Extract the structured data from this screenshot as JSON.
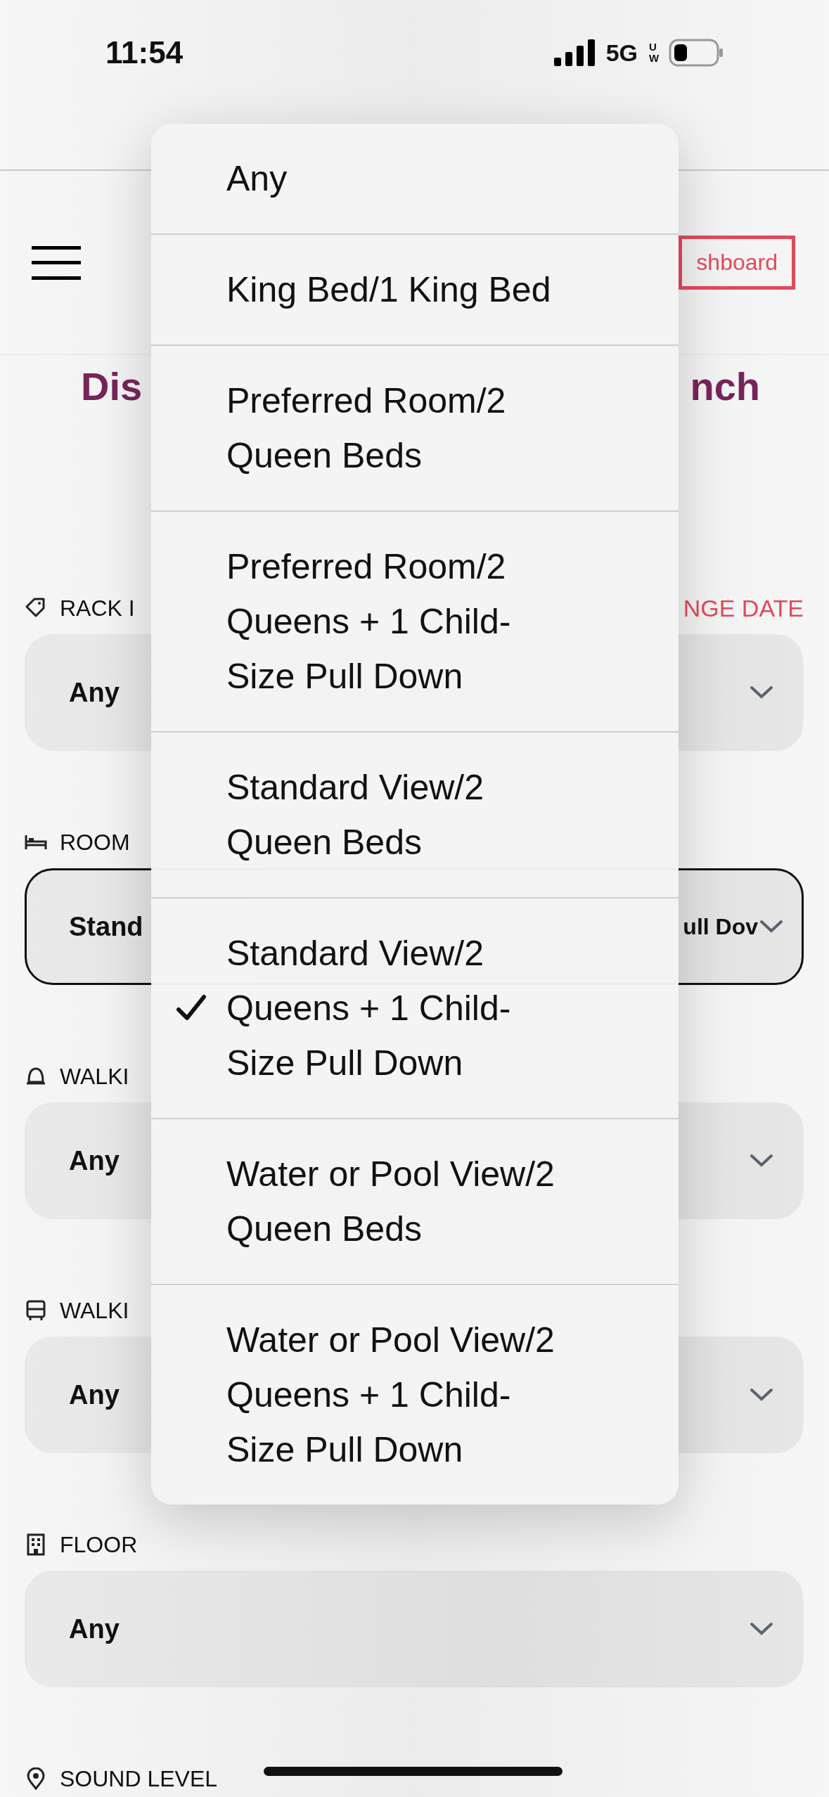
{
  "status_bar": {
    "time": "11:54",
    "network": "5G",
    "network_badge": "UW"
  },
  "header": {
    "dashboard_link": "shboard"
  },
  "title": {
    "left": "Dis",
    "right": "nch"
  },
  "fields": [
    {
      "kind": "tag",
      "label": "RACK I",
      "aside": "NGE DATE",
      "value": "Any",
      "focused": false
    },
    {
      "kind": "bed",
      "label": "ROOM",
      "value": "Stand",
      "value_end": "ull Dov",
      "focused": true
    },
    {
      "kind": "bell",
      "label": "WALKI",
      "value": "Any",
      "focused": false
    },
    {
      "kind": "bus",
      "label": "WALKI",
      "value": "Any",
      "focused": false
    },
    {
      "kind": "building",
      "label": "FLOOR",
      "value": "Any",
      "focused": false
    },
    {
      "kind": "pin",
      "label": "SOUND LEVEL"
    }
  ],
  "menu": {
    "options": [
      {
        "label": "Any",
        "selected": false
      },
      {
        "label": "King Bed/1 King Bed",
        "selected": false
      },
      {
        "label": "Preferred Room/2 Queen Beds",
        "selected": false
      },
      {
        "label": "Preferred Room/2 Queens + 1 Child-Size Pull Down",
        "selected": false
      },
      {
        "label": "Standard View/2 Queen Beds",
        "selected": false
      },
      {
        "label": "Standard View/2 Queens + 1 Child-Size Pull Down",
        "selected": true
      },
      {
        "label": "Water or Pool View/2 Queen Beds",
        "selected": false
      },
      {
        "label": "Water or Pool View/2 Queens + 1 Child-Size Pull Down",
        "selected": false
      }
    ]
  }
}
